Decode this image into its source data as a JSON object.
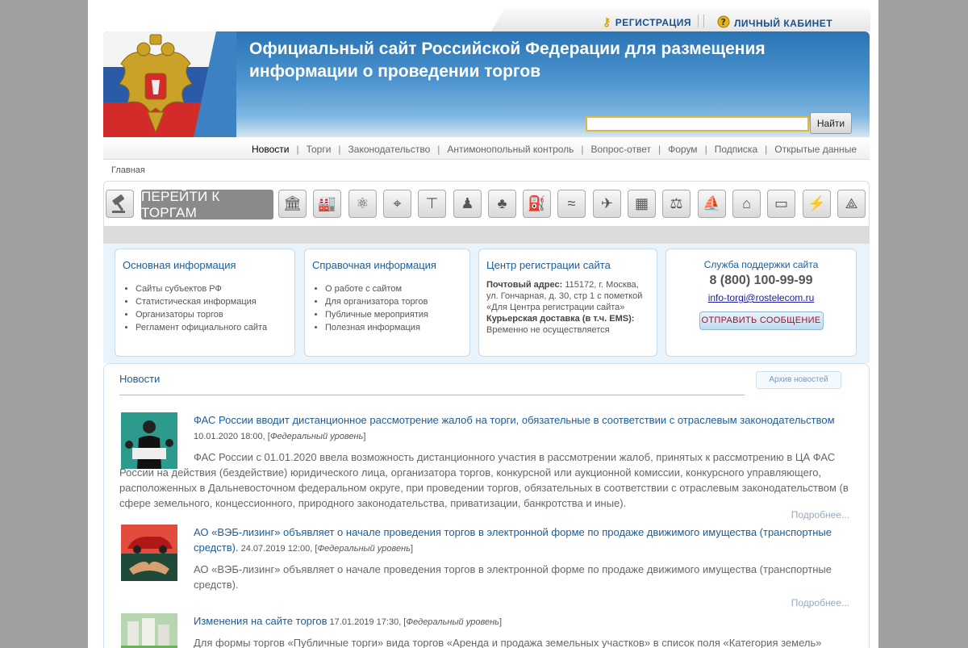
{
  "topbar": {
    "register_label": "РЕГИСТРАЦИЯ",
    "cabinet_label": "ЛИЧНЫЙ КАБИНЕТ"
  },
  "header": {
    "title_line1": "Официальный сайт Российской Федерации для размещения",
    "title_line2": "информации о проведении торгов",
    "search_value": "",
    "search_button": "Найти"
  },
  "nav": {
    "items": [
      {
        "label": "Новости",
        "active": true
      },
      {
        "label": "Торги"
      },
      {
        "label": "Законодательство"
      },
      {
        "label": "Антимонопольный контроль"
      },
      {
        "label": "Вопрос-ответ"
      },
      {
        "label": "Форум"
      },
      {
        "label": "Подписка"
      },
      {
        "label": "Открытые данные"
      }
    ],
    "separator": "|"
  },
  "breadcrumb": "Главная",
  "iconbar": {
    "goto_label": "ПЕРЕЙТИ К ТОРГАМ",
    "icons": [
      "gavel-icon",
      "government-building-icon",
      "factory-icon",
      "atom-icon",
      "theodolite-icon",
      "crane-icon",
      "forest-worker-icon",
      "forest-icon",
      "oil-pump-icon",
      "water-icon",
      "fish-icon",
      "building-icon",
      "scales-icon",
      "jet-ski-icon",
      "flooded-house-icon",
      "billboard-icon",
      "power-tower-icon",
      "radio-tower-icon"
    ]
  },
  "info": {
    "main": {
      "title": "Основная информация",
      "items": [
        "Сайты субъектов РФ",
        "Статистическая информация",
        "Организаторы торгов",
        "Регламент официального сайта"
      ]
    },
    "reference": {
      "title": "Справочная информация",
      "items": [
        "О работе с сайтом",
        "Для организатора торгов",
        "Публичные мероприятия",
        "Полезная информация"
      ]
    },
    "registration": {
      "title": "Центр регистрации сайта",
      "postal_label": "Почтовый адрес:",
      "postal_value": "115172, г. Москва, ул. Гончарная, д. 30, стр 1 с пометкой «Для Центра регистрации сайта»",
      "courier_label": "Курьерская доставка (в т.ч. EMS):",
      "courier_value": "Временно не осуществляется"
    },
    "support": {
      "title": "Служба поддержки сайта",
      "phone": "8 (800) 100-99-99",
      "email": "info-torgi@rostelecom.ru",
      "send_label": "ОТПРАВИТЬ СООБЩЕНИЕ"
    }
  },
  "news": {
    "heading": "Новости",
    "archive_label": "Архив новостей",
    "more_label": "Подробнее...",
    "items": [
      {
        "title": "ФАС России вводит дистанционное рассмотрение жалоб на торги, обязательные в соответствии с отраслевым законодательством",
        "date": "10.01.2020 18:00, [",
        "level": "Федеральный уровень",
        "close": "]",
        "text": "ФАС России с 01.01.2020 ввела возможность дистанционного участия в рассмотрении жалоб, принятых к рассмотрению в ЦА ФАС России на действия (бездействие) юридического лица, организатора торгов, конкурсной или аукционной комиссии, конкурсного управляющего, расположенных в Дальневосточном федеральном округе, при проведении торгов, обязательных в соответствии с отраслевым законодательством (в сфере земельного, концессионного, природного законодательства, приватизации, банкротства и иные)."
      },
      {
        "title": "АО «ВЭБ-лизинг» объявляет о начале проведения торгов в электронной форме по продаже движимого имущества (транспортные средств).",
        "date": " 24.07.2019 12:00, [",
        "level": "Федеральный уровень",
        "close": "]",
        "text": "АО «ВЭБ-лизинг» объявляет о начале проведения торгов в электронной форме по продаже движимого имущества (транспортные средств)."
      },
      {
        "title": "Изменения на сайте торгов",
        "date": " 17.01.2019 17:30, [",
        "level": "Федеральный уровень",
        "close": "]",
        "text": "Для формы торгов «Публичные торги» вида торгов «Аренда и продажа земельных участков» в список поля «Категория земель»"
      }
    ]
  }
}
